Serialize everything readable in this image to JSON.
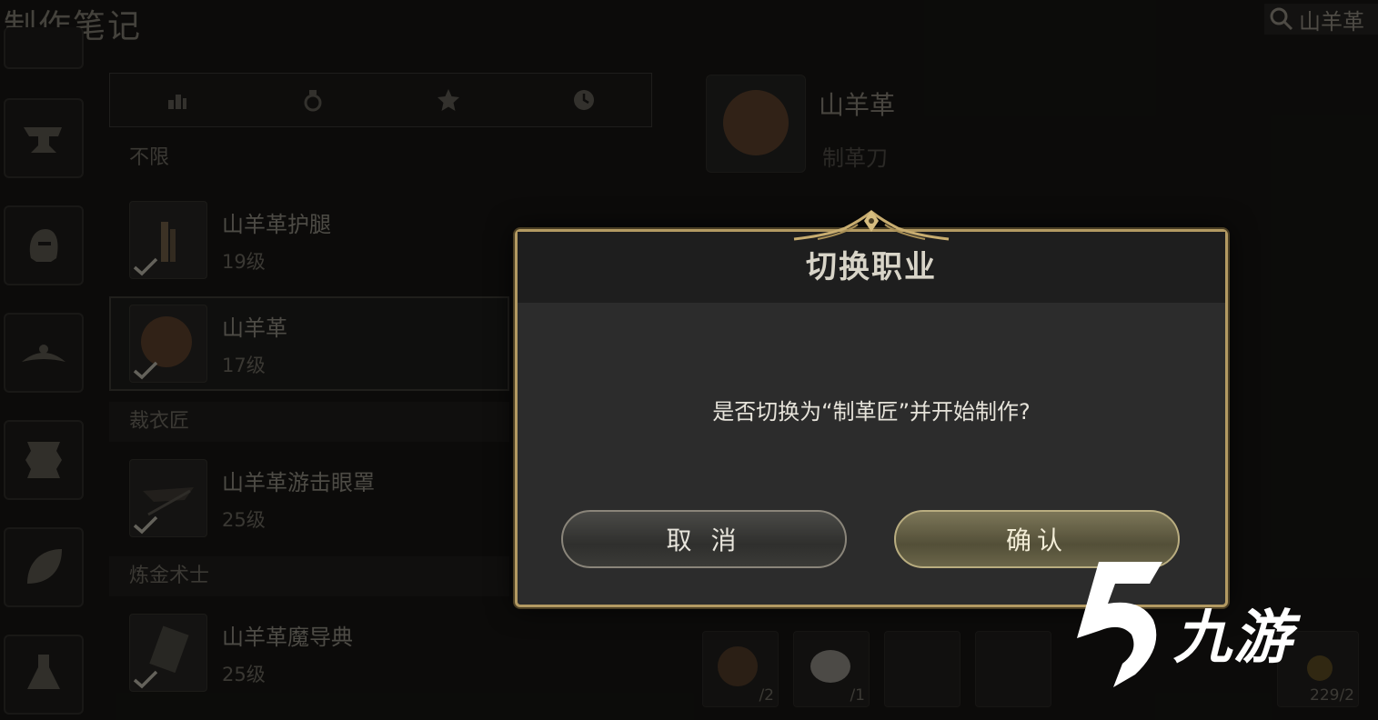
{
  "header": {
    "title": "制作笔记",
    "search_value": "山羊革"
  },
  "filters": [
    "level-icon",
    "bag-icon",
    "star-icon",
    "clock-icon"
  ],
  "list": {
    "unlimited_label": "不限",
    "recipes": [
      {
        "name": "山羊革护腿",
        "level": "19级"
      },
      {
        "name": "山羊革",
        "level": "17级"
      },
      {
        "name": "山羊革游击眼罩",
        "level": "25级"
      },
      {
        "name": "山羊革魔导典",
        "level": "25级"
      }
    ],
    "sections": [
      "裁衣匠",
      "炼金术士"
    ]
  },
  "detail": {
    "name": "山羊革",
    "tool": "制革刀",
    "materials": [
      {
        "count": "/2"
      },
      {
        "count": "/1"
      }
    ],
    "crystal_count": "229/2"
  },
  "dialog": {
    "title": "切换职业",
    "message": "是否切换为“制革匠”并开始制作?",
    "cancel_label": "取 消",
    "confirm_label": "确认"
  },
  "watermark": {
    "text": "九游"
  },
  "colors": {
    "dialog_border": "#b39a62",
    "confirm_button": "#6a6549",
    "cancel_button": "#3a3a37"
  }
}
